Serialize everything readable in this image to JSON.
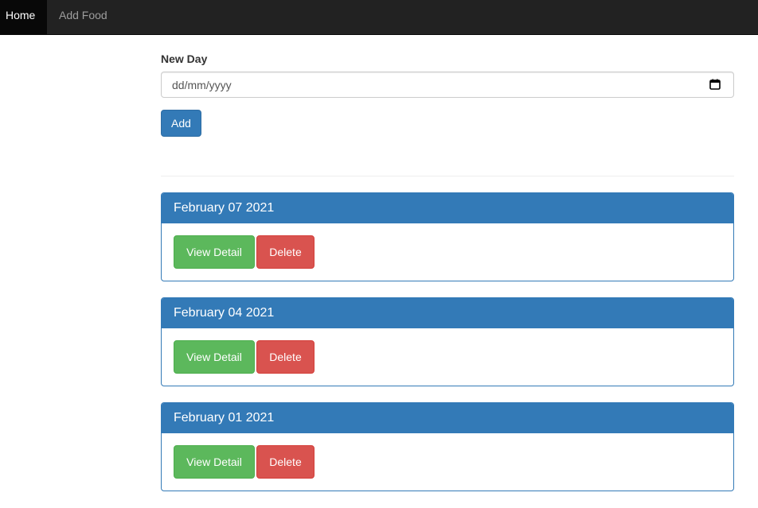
{
  "navbar": {
    "items": [
      {
        "label": "Home",
        "active": true
      },
      {
        "label": "Add Food",
        "active": false
      }
    ]
  },
  "form": {
    "label": "New Day",
    "date_placeholder": "dd/mm/yyyy",
    "calendar_icon": "calendar-icon",
    "add_label": "Add"
  },
  "days": [
    {
      "title": "February 07 2021",
      "view_label": "View Detail",
      "delete_label": "Delete"
    },
    {
      "title": "February 04 2021",
      "view_label": "View Detail",
      "delete_label": "Delete"
    },
    {
      "title": "February 01 2021",
      "view_label": "View Detail",
      "delete_label": "Delete"
    }
  ],
  "colors": {
    "navbar_bg": "#222222",
    "primary": "#337ab7",
    "success": "#5cb85c",
    "danger": "#d9534f"
  }
}
